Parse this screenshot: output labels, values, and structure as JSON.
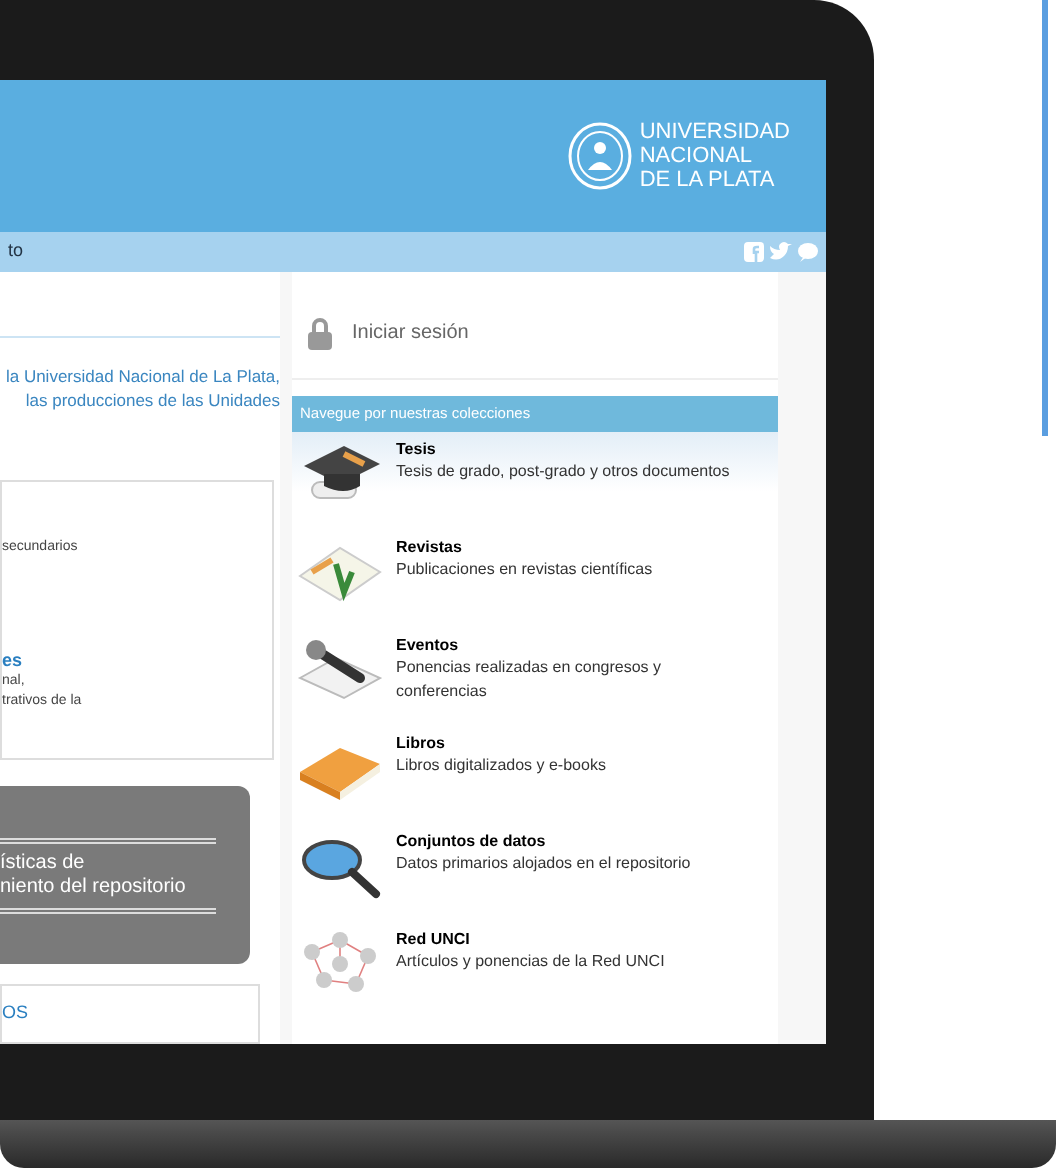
{
  "header": {
    "logo_lines": [
      "UNIVERSIDAD",
      "NACIONAL",
      "DE LA PLATA"
    ]
  },
  "nav_bar": {
    "text": "to"
  },
  "intro": {
    "lines": [
      "la Universidad Nacional de La Plata,",
      "las producciones de las Unidades"
    ]
  },
  "info_box": {
    "lines": [
      {
        "kind": "plain",
        "text": "secundarios"
      },
      {
        "kind": "heading",
        "text": "es"
      },
      {
        "kind": "plain",
        "text": "nal,"
      },
      {
        "kind": "plain",
        "text": "trativos de la"
      }
    ]
  },
  "stats_banner": {
    "lines": [
      "ísticas de",
      "niento del repositorio"
    ]
  },
  "bottom_box": {
    "text": "OS"
  },
  "login": {
    "label": "Iniciar sesión"
  },
  "collections": {
    "title": "Navegue por nuestras colecciones",
    "items": [
      {
        "kind": "cap",
        "title": "Tesis",
        "description": "Tesis de grado, post-grado y otros documentos"
      },
      {
        "kind": "journal",
        "title": "Revistas",
        "description": "Publicaciones en revistas científicas"
      },
      {
        "kind": "microphone",
        "title": "Eventos",
        "description": "Ponencias realizadas en congresos y conferencias"
      },
      {
        "kind": "book",
        "title": "Libros",
        "description": "Libros digitalizados y e-books"
      },
      {
        "kind": "magnifier",
        "title": "Conjuntos de datos",
        "description": "Datos primarios alojados en el repositorio"
      },
      {
        "kind": "network",
        "title": "Red UNCI",
        "description": "Artículos y ponencias de la Red UNCI"
      }
    ]
  }
}
